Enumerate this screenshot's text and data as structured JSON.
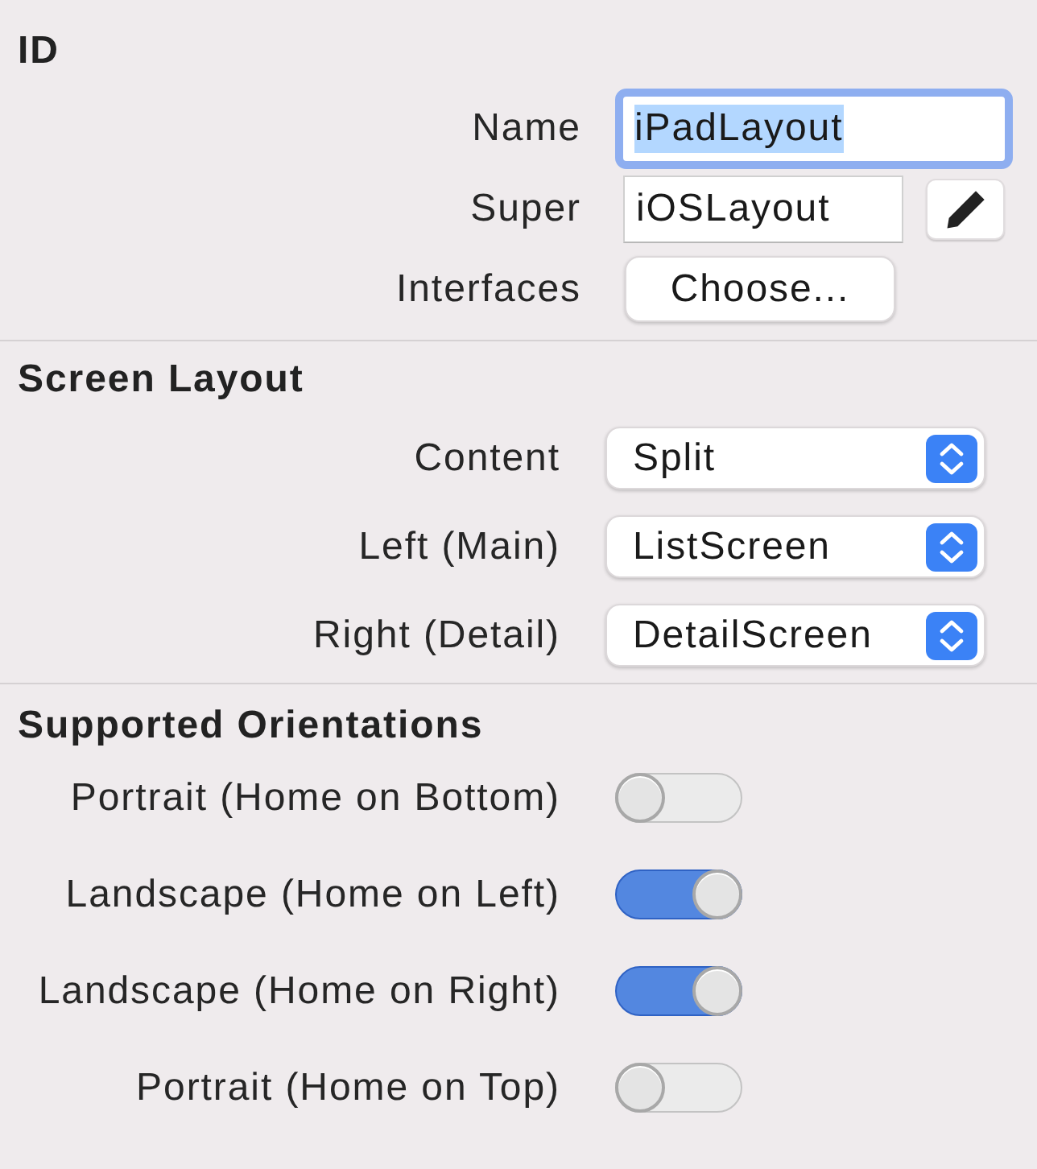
{
  "id_section": {
    "title": "ID",
    "name": {
      "label": "Name",
      "value": "iPadLayout",
      "focused": true
    },
    "super": {
      "label": "Super",
      "value": "iOSLayout"
    },
    "interfaces": {
      "label": "Interfaces",
      "button": "Choose..."
    }
  },
  "screen_layout": {
    "title": "Screen Layout",
    "popups": [
      {
        "label": "Content",
        "value": "Split"
      },
      {
        "label": "Left (Main)",
        "value": "ListScreen"
      },
      {
        "label": "Right (Detail)",
        "value": "DetailScreen"
      }
    ]
  },
  "supported_orientations": {
    "title": "Supported Orientations",
    "toggles": [
      {
        "label": "Portrait (Home on Bottom)",
        "on": false
      },
      {
        "label": "Landscape (Home on Left)",
        "on": true
      },
      {
        "label": "Landscape (Home on Right)",
        "on": true
      },
      {
        "label": "Portrait (Home on Top)",
        "on": false
      }
    ]
  }
}
